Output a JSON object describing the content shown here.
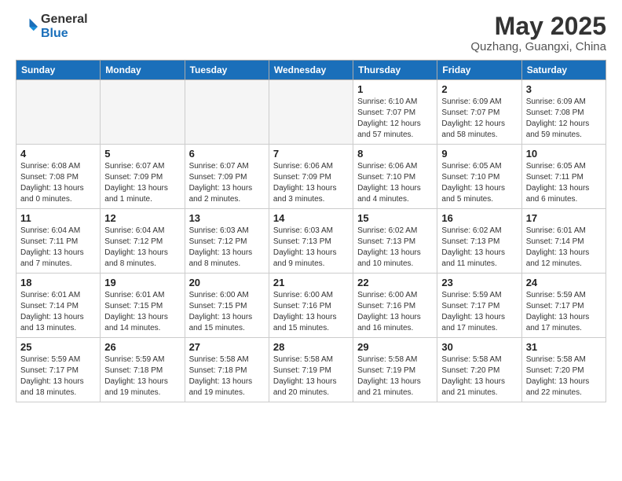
{
  "logo": {
    "general": "General",
    "blue": "Blue"
  },
  "header": {
    "month": "May 2025",
    "location": "Quzhang, Guangxi, China"
  },
  "weekdays": [
    "Sunday",
    "Monday",
    "Tuesday",
    "Wednesday",
    "Thursday",
    "Friday",
    "Saturday"
  ],
  "weeks": [
    [
      {
        "day": "",
        "empty": true
      },
      {
        "day": "",
        "empty": true
      },
      {
        "day": "",
        "empty": true
      },
      {
        "day": "",
        "empty": true
      },
      {
        "day": "1",
        "sunrise": "6:10 AM",
        "sunset": "7:07 PM",
        "daylight": "12 hours and 57 minutes."
      },
      {
        "day": "2",
        "sunrise": "6:09 AM",
        "sunset": "7:07 PM",
        "daylight": "12 hours and 58 minutes."
      },
      {
        "day": "3",
        "sunrise": "6:09 AM",
        "sunset": "7:08 PM",
        "daylight": "12 hours and 59 minutes."
      }
    ],
    [
      {
        "day": "4",
        "sunrise": "6:08 AM",
        "sunset": "7:08 PM",
        "daylight": "13 hours and 0 minutes."
      },
      {
        "day": "5",
        "sunrise": "6:07 AM",
        "sunset": "7:09 PM",
        "daylight": "13 hours and 1 minute."
      },
      {
        "day": "6",
        "sunrise": "6:07 AM",
        "sunset": "7:09 PM",
        "daylight": "13 hours and 2 minutes."
      },
      {
        "day": "7",
        "sunrise": "6:06 AM",
        "sunset": "7:09 PM",
        "daylight": "13 hours and 3 minutes."
      },
      {
        "day": "8",
        "sunrise": "6:06 AM",
        "sunset": "7:10 PM",
        "daylight": "13 hours and 4 minutes."
      },
      {
        "day": "9",
        "sunrise": "6:05 AM",
        "sunset": "7:10 PM",
        "daylight": "13 hours and 5 minutes."
      },
      {
        "day": "10",
        "sunrise": "6:05 AM",
        "sunset": "7:11 PM",
        "daylight": "13 hours and 6 minutes."
      }
    ],
    [
      {
        "day": "11",
        "sunrise": "6:04 AM",
        "sunset": "7:11 PM",
        "daylight": "13 hours and 7 minutes."
      },
      {
        "day": "12",
        "sunrise": "6:04 AM",
        "sunset": "7:12 PM",
        "daylight": "13 hours and 8 minutes."
      },
      {
        "day": "13",
        "sunrise": "6:03 AM",
        "sunset": "7:12 PM",
        "daylight": "13 hours and 8 minutes."
      },
      {
        "day": "14",
        "sunrise": "6:03 AM",
        "sunset": "7:13 PM",
        "daylight": "13 hours and 9 minutes."
      },
      {
        "day": "15",
        "sunrise": "6:02 AM",
        "sunset": "7:13 PM",
        "daylight": "13 hours and 10 minutes."
      },
      {
        "day": "16",
        "sunrise": "6:02 AM",
        "sunset": "7:13 PM",
        "daylight": "13 hours and 11 minutes."
      },
      {
        "day": "17",
        "sunrise": "6:01 AM",
        "sunset": "7:14 PM",
        "daylight": "13 hours and 12 minutes."
      }
    ],
    [
      {
        "day": "18",
        "sunrise": "6:01 AM",
        "sunset": "7:14 PM",
        "daylight": "13 hours and 13 minutes."
      },
      {
        "day": "19",
        "sunrise": "6:01 AM",
        "sunset": "7:15 PM",
        "daylight": "13 hours and 14 minutes."
      },
      {
        "day": "20",
        "sunrise": "6:00 AM",
        "sunset": "7:15 PM",
        "daylight": "13 hours and 15 minutes."
      },
      {
        "day": "21",
        "sunrise": "6:00 AM",
        "sunset": "7:16 PM",
        "daylight": "13 hours and 15 minutes."
      },
      {
        "day": "22",
        "sunrise": "6:00 AM",
        "sunset": "7:16 PM",
        "daylight": "13 hours and 16 minutes."
      },
      {
        "day": "23",
        "sunrise": "5:59 AM",
        "sunset": "7:17 PM",
        "daylight": "13 hours and 17 minutes."
      },
      {
        "day": "24",
        "sunrise": "5:59 AM",
        "sunset": "7:17 PM",
        "daylight": "13 hours and 17 minutes."
      }
    ],
    [
      {
        "day": "25",
        "sunrise": "5:59 AM",
        "sunset": "7:17 PM",
        "daylight": "13 hours and 18 minutes."
      },
      {
        "day": "26",
        "sunrise": "5:59 AM",
        "sunset": "7:18 PM",
        "daylight": "13 hours and 19 minutes."
      },
      {
        "day": "27",
        "sunrise": "5:58 AM",
        "sunset": "7:18 PM",
        "daylight": "13 hours and 19 minutes."
      },
      {
        "day": "28",
        "sunrise": "5:58 AM",
        "sunset": "7:19 PM",
        "daylight": "13 hours and 20 minutes."
      },
      {
        "day": "29",
        "sunrise": "5:58 AM",
        "sunset": "7:19 PM",
        "daylight": "13 hours and 21 minutes."
      },
      {
        "day": "30",
        "sunrise": "5:58 AM",
        "sunset": "7:20 PM",
        "daylight": "13 hours and 21 minutes."
      },
      {
        "day": "31",
        "sunrise": "5:58 AM",
        "sunset": "7:20 PM",
        "daylight": "13 hours and 22 minutes."
      }
    ]
  ]
}
